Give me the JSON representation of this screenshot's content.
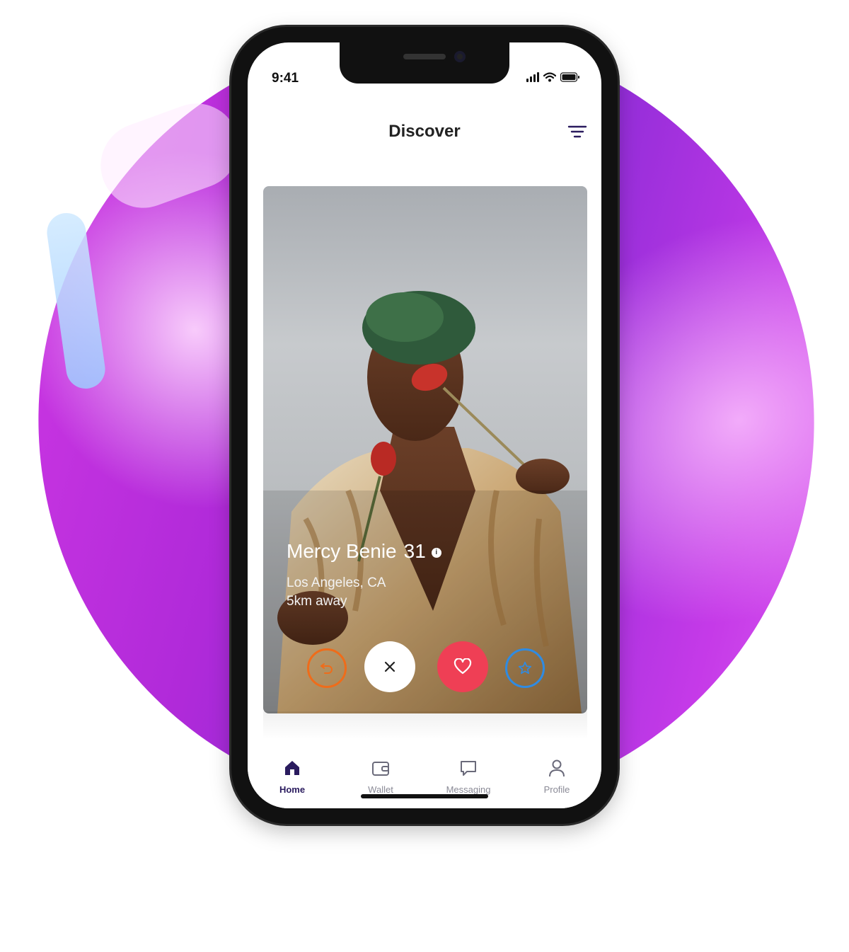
{
  "status_bar": {
    "time": "9:41"
  },
  "header": {
    "title": "Discover",
    "filter_icon": "filter-icon"
  },
  "profile": {
    "name": "Mercy Benie",
    "age": "31",
    "location": "Los Angeles, CA",
    "distance": "5km away"
  },
  "actions": [
    {
      "name": "rewind",
      "icon": "rewind-icon",
      "color": "#ef6c1a"
    },
    {
      "name": "dislike",
      "icon": "close-icon",
      "color": "#222222"
    },
    {
      "name": "like",
      "icon": "heart-icon",
      "color": "#ef3f55"
    },
    {
      "name": "super-like",
      "icon": "star-icon",
      "color": "#2f8be2"
    }
  ],
  "tabs": [
    {
      "label": "Home",
      "icon": "home-icon",
      "active": true
    },
    {
      "label": "Wallet",
      "icon": "wallet-icon",
      "active": false
    },
    {
      "label": "Messaging",
      "icon": "chat-icon",
      "active": false
    },
    {
      "label": "Profile",
      "icon": "user-icon",
      "active": false
    }
  ],
  "colors": {
    "accent": "#2a1b5e",
    "blob": "#c03ae6"
  }
}
